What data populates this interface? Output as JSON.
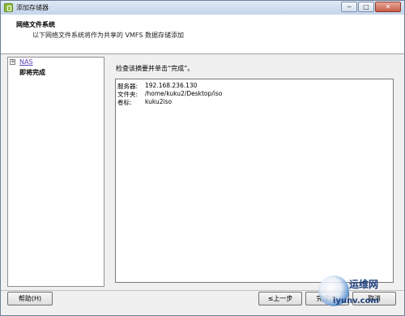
{
  "window": {
    "title": "添加存储器",
    "controls": [
      "─",
      "□",
      "✕"
    ]
  },
  "header": {
    "title": "网络文件系统",
    "subtitle": "以下网络文件系统将作为共享的 VMFS 数据存储添加"
  },
  "sidebar": {
    "expander": "+",
    "items": [
      {
        "label": "NAS",
        "kind": "link"
      },
      {
        "label": "即将完成",
        "kind": "current"
      }
    ]
  },
  "content": {
    "instruction": "检查该摘要并单击“完成”。",
    "summary": [
      {
        "label": "服务器:",
        "value": "192.168.236.130"
      },
      {
        "label": "文件夹:",
        "value": "/home/kuku2/Desktop/iso"
      },
      {
        "label": "卷标:",
        "value": "kuku2iso"
      }
    ]
  },
  "buttons": {
    "help": "帮助(H)",
    "back": "≤上一步",
    "finish": "完成(F)",
    "cancel": "取消"
  },
  "watermark": {
    "line1": "运维网",
    "line2": "iyunv.com"
  }
}
